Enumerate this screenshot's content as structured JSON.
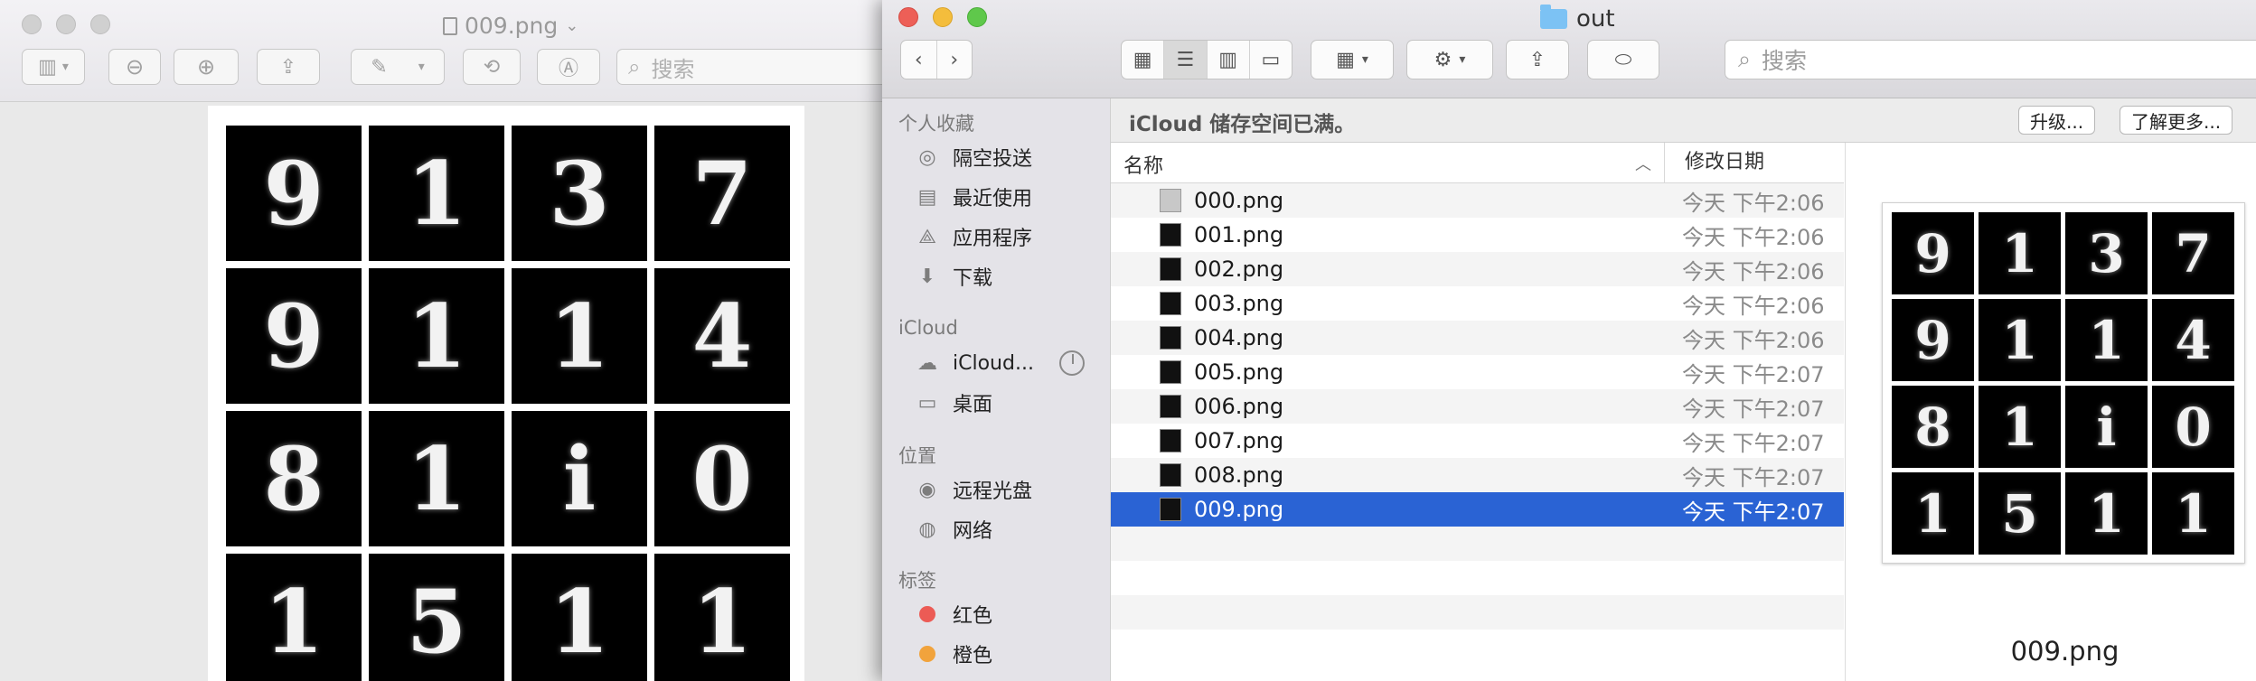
{
  "preview": {
    "title": "009.png",
    "search_placeholder": "搜索",
    "digits": [
      "9",
      "1",
      "3",
      "7",
      "9",
      "1",
      "1",
      "4",
      "8",
      "1",
      "i",
      "0",
      "1",
      "5",
      "1",
      "1"
    ]
  },
  "finder": {
    "title": "out",
    "search_placeholder": "搜索",
    "banner": {
      "text": "iCloud 储存空间已满。",
      "upgrade": "升级...",
      "learn_more": "了解更多..."
    },
    "sidebar": {
      "favorites_header": "个人收藏",
      "favorites": [
        "隔空投送",
        "最近使用",
        "应用程序",
        "下载"
      ],
      "icloud_header": "iCloud",
      "icloud": [
        "iCloud...",
        "桌面"
      ],
      "locations_header": "位置",
      "locations": [
        "远程光盘",
        "网络"
      ],
      "tags_header": "标签",
      "tags": [
        {
          "label": "红色",
          "color": "#ec5b55"
        },
        {
          "label": "橙色",
          "color": "#f1a33c"
        }
      ]
    },
    "columns": {
      "name": "名称",
      "date": "修改日期"
    },
    "files": [
      {
        "name": "000.png",
        "date": "今天 下午2:06"
      },
      {
        "name": "001.png",
        "date": "今天 下午2:06"
      },
      {
        "name": "002.png",
        "date": "今天 下午2:06"
      },
      {
        "name": "003.png",
        "date": "今天 下午2:06"
      },
      {
        "name": "004.png",
        "date": "今天 下午2:06"
      },
      {
        "name": "005.png",
        "date": "今天 下午2:07"
      },
      {
        "name": "006.png",
        "date": "今天 下午2:07"
      },
      {
        "name": "007.png",
        "date": "今天 下午2:07"
      },
      {
        "name": "008.png",
        "date": "今天 下午2:07"
      },
      {
        "name": "009.png",
        "date": "今天 下午2:07"
      }
    ],
    "selected_file": "009.png",
    "preview_name": "009.png",
    "accent_color": "#2a63d4"
  }
}
